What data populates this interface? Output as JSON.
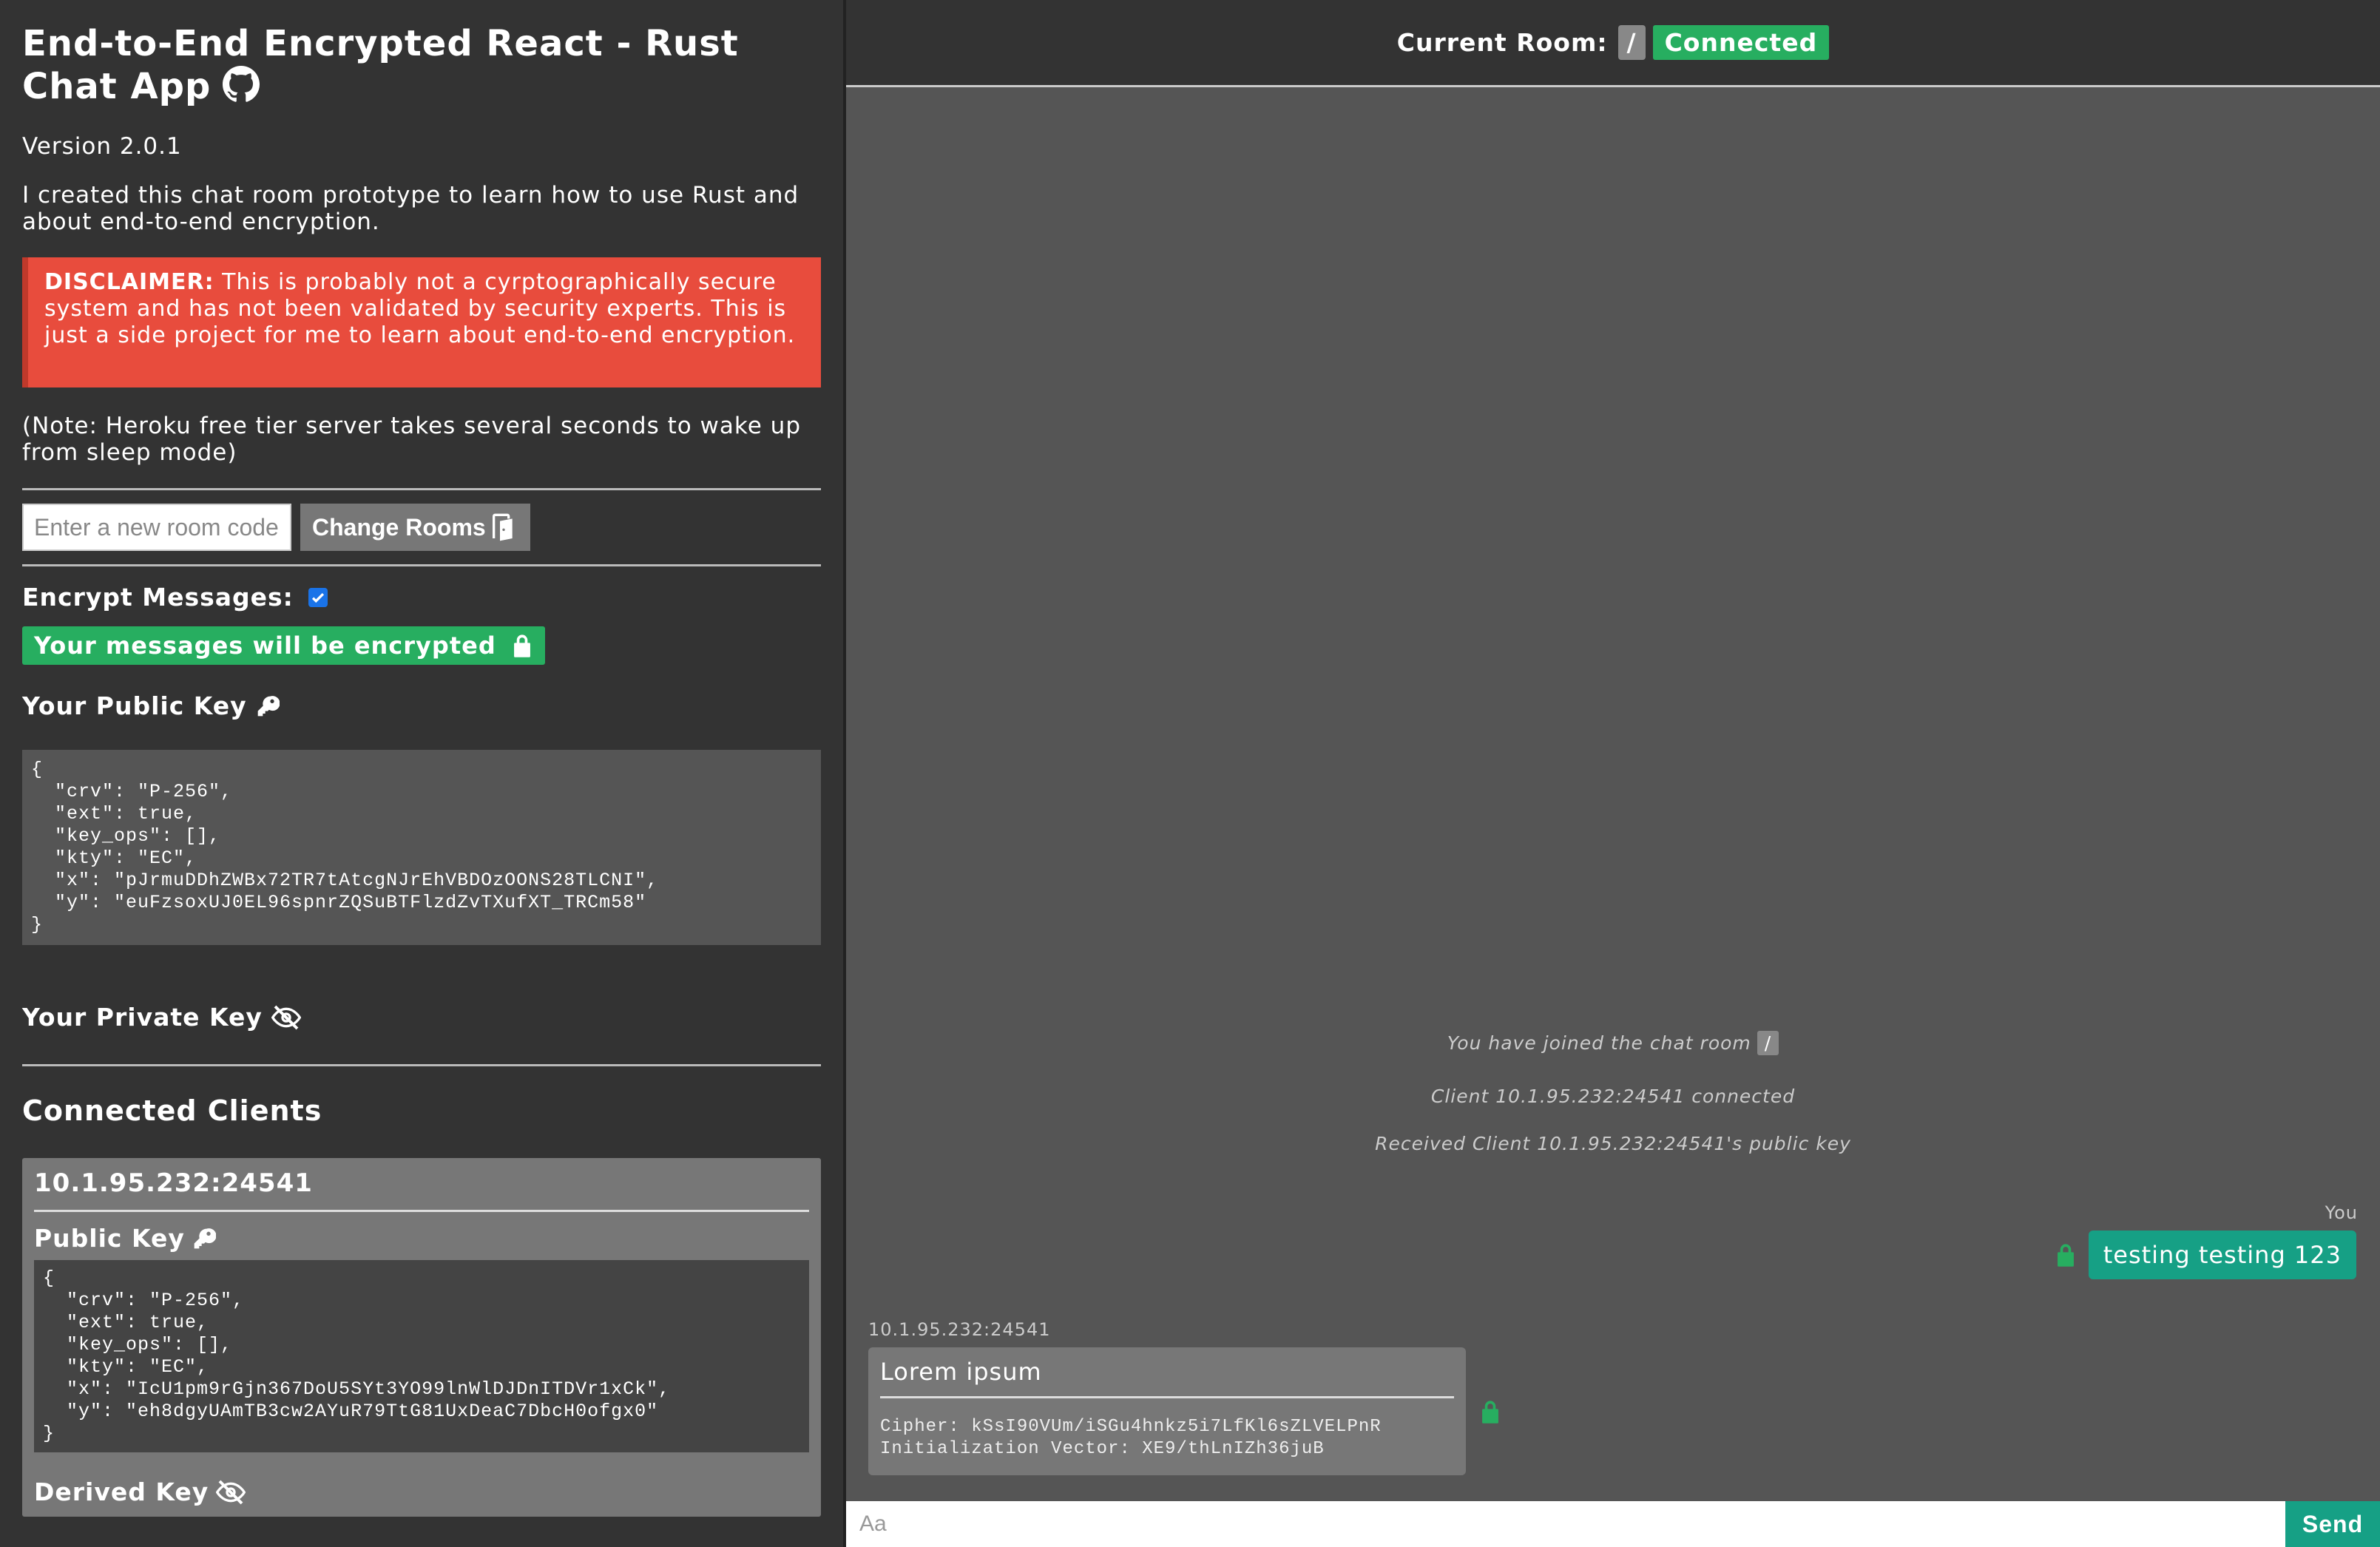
{
  "sidebar": {
    "title": "End-to-End Encrypted React - Rust Chat App",
    "version": "Version 2.0.1",
    "intro": "I created this chat room prototype to learn how to use Rust and about end-to-end encryption.",
    "disclaimer_label": "DISCLAIMER:",
    "disclaimer_text": " This is probably not a cyrptographically secure system and has not been validated by security experts. This is just a side project for me to learn about end-to-end encryption.",
    "note": "(Note: Heroku free tier server takes several seconds to wake up from sleep mode)",
    "room_input_placeholder": "Enter a new room code",
    "change_rooms_label": "Change Rooms",
    "encrypt_label": "Encrypt Messages:",
    "encrypt_checked": true,
    "encrypted_badge": "Your messages will be encrypted",
    "public_key_heading": "Your Public Key",
    "public_key_json": "{\n  \"crv\": \"P-256\",\n  \"ext\": true,\n  \"key_ops\": [],\n  \"kty\": \"EC\",\n  \"x\": \"pJrmuDDhZWBx72TR7tAtcgNJrEhVBDOzOONS28TLCNI\",\n  \"y\": \"euFzsoxUJ0EL96spnrZQSuBTFlzdZvTXufXT_TRCm58\"\n}",
    "private_key_heading": "Your Private Key",
    "connected_clients_heading": "Connected Clients",
    "clients": [
      {
        "address": "10.1.95.232:24541",
        "public_key_heading": "Public Key",
        "public_key_json": "{\n  \"crv\": \"P-256\",\n  \"ext\": true,\n  \"key_ops\": [],\n  \"kty\": \"EC\",\n  \"x\": \"IcU1pm9rGjn367DoU5SYt3YO99lnWlDJDnITDVr1xCk\",\n  \"y\": \"eh8dgyUAmTB3cw2AYuR79TtG81UxDeaC7DbcH0ofgx0\"\n}",
        "derived_key_heading": "Derived Key"
      }
    ]
  },
  "header": {
    "current_room_label": "Current Room:",
    "room_code": "/",
    "status": "Connected"
  },
  "chat": {
    "system_messages": [
      {
        "text": "You have joined the chat room",
        "room": "/"
      },
      {
        "text": "Client 10.1.95.232:24541 connected"
      },
      {
        "text": "Received Client 10.1.95.232:24541's public key"
      }
    ],
    "my_message": {
      "sender": "You",
      "text": "testing testing 123"
    },
    "peer_message": {
      "sender": "10.1.95.232:24541",
      "text": "Lorem ipsum",
      "cipher": "Cipher: kSsI90VUm/iSGu4hnkz5i7LfKl6sZLVELPnR",
      "iv": "Initialization Vector: XE9/thLnIZh36juB"
    },
    "composer_placeholder": "Aa",
    "send_label": "Send"
  },
  "colors": {
    "accent_green": "#27ae60",
    "bubble_teal": "#16a085",
    "disclaimer_red": "#e84c3d"
  }
}
